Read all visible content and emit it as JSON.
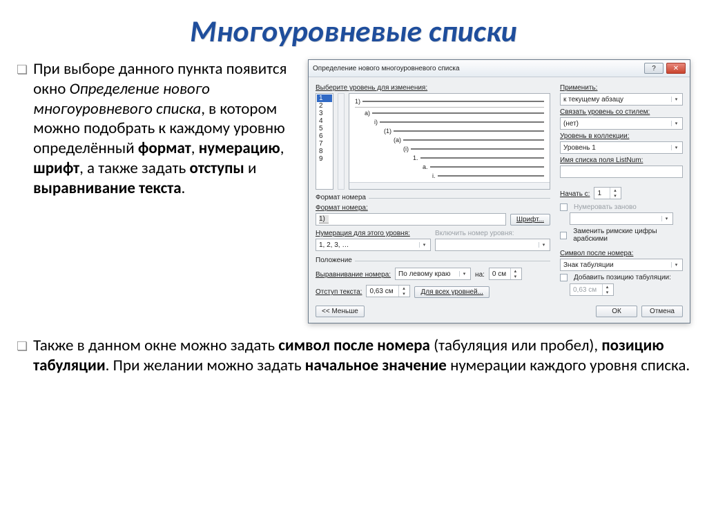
{
  "title": "Многоуровневые списки",
  "para1": {
    "pre": "При выборе данного пункта появится окно ",
    "italic": "Определение нового многоуровневого списка",
    "mid1": ", в котором можно подобрать к каждому уровню определённый ",
    "b1": "формат",
    "sep1": ", ",
    "b2": "нумерацию",
    "sep2": ", ",
    "b3": "шрифт",
    "mid2": ", а также задать ",
    "b4": "отступы",
    "mid3": " и ",
    "b5": "выравнивание текста",
    "end": "."
  },
  "para2": {
    "pre": "Также в данном окне можно задать ",
    "b1": "символ после номера",
    "mid1": " (табуляция или пробел), ",
    "b2": "позицию табуляции",
    "mid2": ". При желании можно задать ",
    "b3": "начальное значение",
    "end": " нумерации каждого уровня списка."
  },
  "dialog": {
    "title": "Определение нового многоуровневого списка",
    "select_level": "Выберите уровень для изменения:",
    "levels": [
      "1",
      "2",
      "3",
      "4",
      "5",
      "6",
      "7",
      "8",
      "9"
    ],
    "apply_to_label": "Применить:",
    "apply_to_value": "к текущему абзацу",
    "link_style_label": "Связать уровень со стилем:",
    "link_style_value": "(нет)",
    "collection_label": "Уровень в коллекции:",
    "collection_value": "Уровень 1",
    "listnum_label": "Имя списка поля ListNum:",
    "section_format": "Формат номера",
    "number_format_label": "Формат номера:",
    "number_format_value": "1)",
    "font_btn": "Шрифт...",
    "start_at_label": "Начать с:",
    "start_at_value": "1",
    "restart_label": "Нумеровать заново",
    "numbering_label": "Нумерация для этого уровня:",
    "numbering_value": "1, 2, 3, …",
    "include_level_label": "Включить номер уровня:",
    "replace_roman": "Заменить римские цифры арабскими",
    "section_position": "Положение",
    "align_label": "Выравнивание номера:",
    "align_value": "По левому краю",
    "at_label": "на:",
    "at_value": "0 см",
    "symbol_after_label": "Символ после номера:",
    "symbol_after_value": "Знак табуляции",
    "indent_label": "Отступ текста:",
    "indent_value": "0,63 см",
    "all_levels_btn": "Для всех уровней...",
    "add_tab_pos": "Добавить позицию табуляции:",
    "tab_pos_value": "0,63 см",
    "less_btn": "<< Меньше",
    "ok": "ОК",
    "cancel": "Отмена",
    "preview_labels": [
      "1)",
      "a)",
      "i)",
      "(1)",
      "(a)",
      "(i)",
      "1.",
      "a.",
      "i."
    ]
  }
}
